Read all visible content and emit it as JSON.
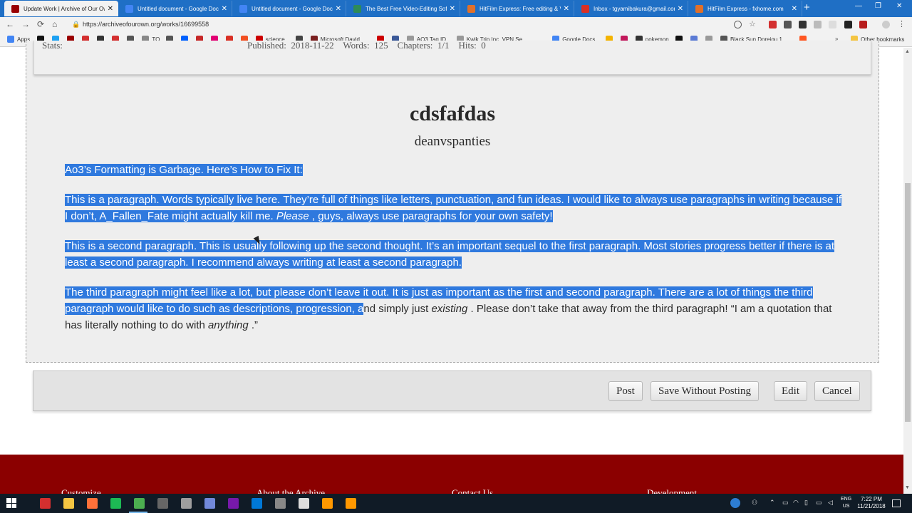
{
  "browser": {
    "tabs": [
      {
        "title": "Update Work | Archive of Our Own",
        "color": "#990000",
        "active": true
      },
      {
        "title": "Untitled document - Google Docs",
        "color": "#4285f4",
        "active": false
      },
      {
        "title": "Untitled document - Google Docs",
        "color": "#4285f4",
        "active": false
      },
      {
        "title": "The Best Free Video-Editing Software",
        "color": "#2e8b57",
        "active": false
      },
      {
        "title": "HitFilm Express: Free editing & VFX",
        "color": "#e0702a",
        "active": false
      },
      {
        "title": "Inbox - tgyamibakura@gmail.com",
        "color": "#d93025",
        "active": false
      },
      {
        "title": "HitFilm Express - fxhome.com",
        "color": "#e0702a",
        "active": false
      }
    ],
    "tab_close_glyph": "✕",
    "new_tab_glyph": "+",
    "window_controls": {
      "minimize": "—",
      "maximize": "❐",
      "close": "✕"
    },
    "nav": {
      "back": "←",
      "forward": "→",
      "reload": "⟳",
      "home": "⌂"
    },
    "lock_glyph": "🔒",
    "url": "https://archiveofourown.org/works/16699558",
    "bookmarks": [
      {
        "label": "Apps",
        "color": "#4285f4"
      },
      {
        "label": "",
        "color": "#111111"
      },
      {
        "label": "",
        "color": "#1da1f2"
      },
      {
        "label": "",
        "color": "#990000"
      },
      {
        "label": "",
        "color": "#d32f2f"
      },
      {
        "label": "",
        "color": "#333333"
      },
      {
        "label": "",
        "color": "#d32f2f"
      },
      {
        "label": "",
        "color": "#555555"
      },
      {
        "label": "TO",
        "color": "#888888"
      },
      {
        "label": "",
        "color": "#555555"
      },
      {
        "label": "",
        "color": "#0061fe"
      },
      {
        "label": "",
        "color": "#c62828"
      },
      {
        "label": "",
        "color": "#e20074"
      },
      {
        "label": "",
        "color": "#d93025"
      },
      {
        "label": "",
        "color": "#f25022"
      },
      {
        "label": "science",
        "color": "#cc0000"
      },
      {
        "label": "",
        "color": "#444444"
      },
      {
        "label": "Microsoft David",
        "color": "#7a1f1f"
      },
      {
        "label": "",
        "color": "#cc0000"
      },
      {
        "label": "",
        "color": "#3b5998"
      },
      {
        "label": "AO3 Tag ID",
        "color": "#999999"
      },
      {
        "label": "Kwik Trip Inc. VPN Se...",
        "color": "#999999"
      },
      {
        "label": "Google Docs",
        "color": "#4285f4"
      },
      {
        "label": "",
        "color": "#f4b400"
      },
      {
        "label": "",
        "color": "#c2185b"
      },
      {
        "label": "pokemon",
        "color": "#333333"
      },
      {
        "label": "",
        "color": "#111111"
      },
      {
        "label": "",
        "color": "#5b7bd5"
      },
      {
        "label": "",
        "color": "#999999"
      },
      {
        "label": "Black Sun Doreiou 1",
        "color": "#555555"
      },
      {
        "label": "",
        "color": "#ff5722"
      }
    ],
    "more_glyph": "»",
    "other_bookmarks": "Other bookmarks"
  },
  "work": {
    "stats_label": "Stats:",
    "stats_values": "Published:  2018-11-22    Words:  125    Chapters:  1/1    Hits:  0",
    "title": "cdsfafdas",
    "author": "deanvspanties",
    "heading": "Ao3’s Formatting is Garbage. Here’s How to Fix It:",
    "p1_a": "This is a paragraph. Words typically live here. They’re full of things like letters, punctuation, and fun ideas. I would like to always use paragraphs in writing because if I don’t, A_Fallen_Fate might actually kill me. ",
    "p1_em": "Please",
    "p1_b": " , guys, always use paragraphs for your own safety!",
    "p2": "This is a second paragraph. This is usually following up the second thought. It’s an important sequel to the first paragraph. Most stories progress better if there is at least a second paragraph. I recommend always writing at least a second paragraph.",
    "p3_selected": "The third paragraph might feel like a lot, but please don’t leave it out. It is just as important as the first and second paragraph. There are a lot of things the third paragraph would like to do such as descriptions, progression, a",
    "p3_rest_a": "nd simply just ",
    "p3_em1": "existing",
    "p3_rest_b": " . Please don’t take that away from the third paragraph! “I am a quotation that has literally nothing to do with ",
    "p3_em2": "anything",
    "p3_rest_c": " .”"
  },
  "actions": {
    "post": "Post",
    "save_without_posting": "Save Without Posting",
    "edit": "Edit",
    "cancel": "Cancel"
  },
  "footer": {
    "columns": [
      "Customize",
      "About the Archive",
      "Contact Us",
      "Development"
    ]
  },
  "taskbar": {
    "apps": [
      {
        "name": "ao3-app-icon",
        "color": "#d32f2f"
      },
      {
        "name": "file-explorer-icon",
        "color": "#f4c542"
      },
      {
        "name": "firefox-icon",
        "color": "#ff7139"
      },
      {
        "name": "spotify-icon",
        "color": "#1db954"
      },
      {
        "name": "chrome-icon",
        "color": "#4caf50"
      },
      {
        "name": "calculator-icon",
        "color": "#666666"
      },
      {
        "name": "settings-app-icon",
        "color": "#9e9e9e"
      },
      {
        "name": "discord-icon",
        "color": "#7289da"
      },
      {
        "name": "onenote-icon",
        "color": "#7719aa"
      },
      {
        "name": "edge-icon",
        "color": "#0078d7"
      },
      {
        "name": "clock-app-icon",
        "color": "#888888"
      },
      {
        "name": "photos-icon",
        "color": "#dddddd"
      },
      {
        "name": "hitfilm-icon",
        "color": "#ff9800"
      },
      {
        "name": "hitfilm-editor-icon",
        "color": "#ff9800"
      }
    ],
    "lang_line1": "ENG",
    "lang_line2": "US",
    "time": "7:22 PM",
    "date": "11/21/2018"
  }
}
